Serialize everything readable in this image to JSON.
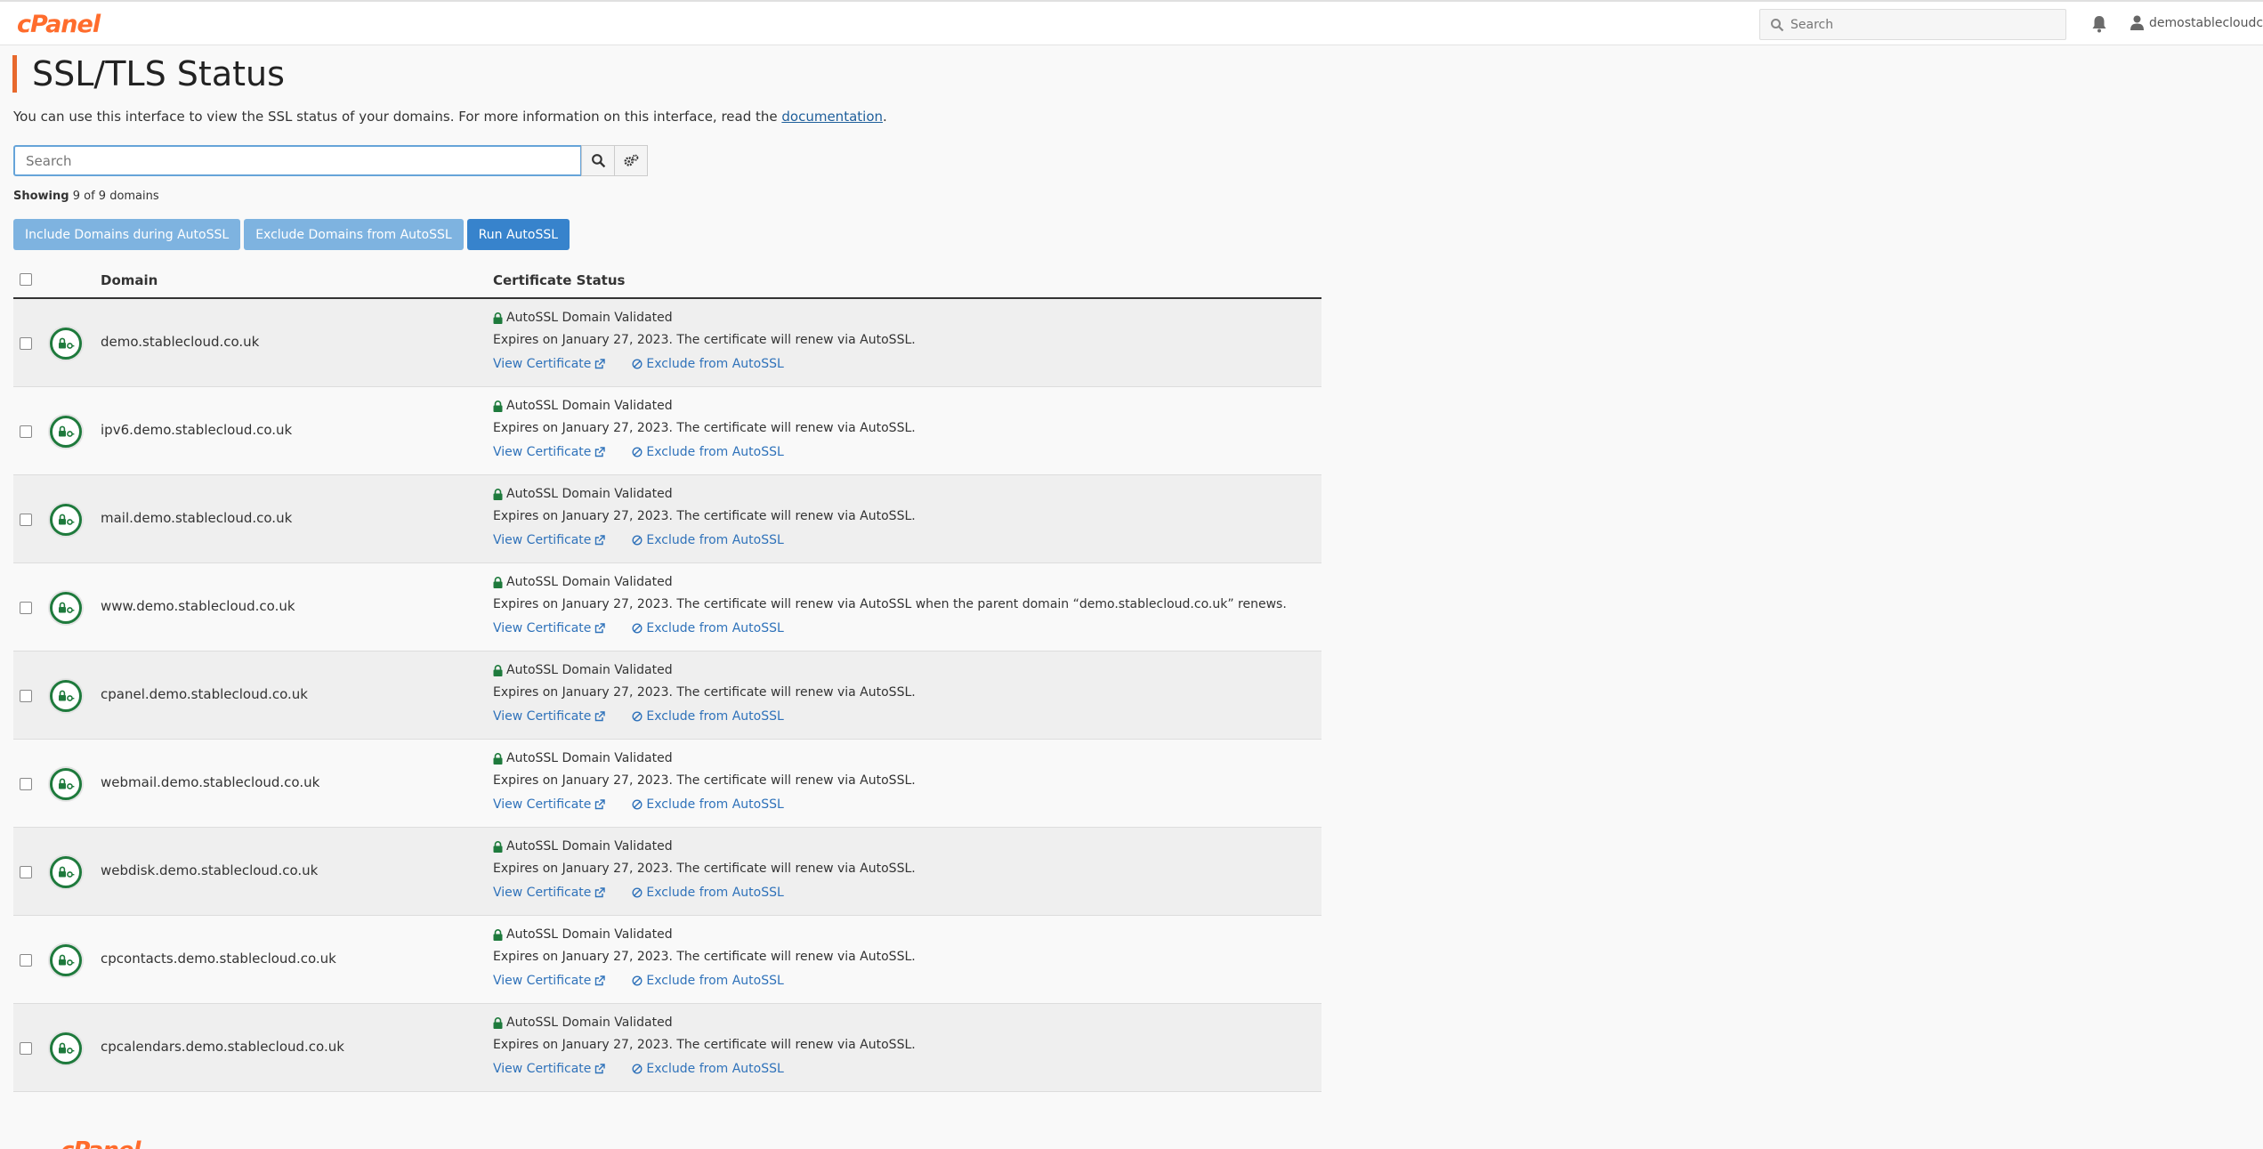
{
  "header": {
    "logo": "cPanel",
    "search_placeholder": "Search",
    "username": "demostablecloudc"
  },
  "page": {
    "title": "SSL/TLS Status",
    "intro_text": "You can use this interface to view the SSL status of your domains. For more information on this interface, read the ",
    "intro_link": "documentation",
    "intro_end": ".",
    "search_placeholder": "Search",
    "showing_label": "Showing",
    "showing_count": "9 of 9 domains"
  },
  "buttons": {
    "include": "Include Domains during AutoSSL",
    "exclude": "Exclude Domains from AutoSSL",
    "run": "Run AutoSSL"
  },
  "table": {
    "col_domain": "Domain",
    "col_status": "Certificate Status",
    "rows": [
      {
        "domain": "demo.stablecloud.co.uk",
        "status": "AutoSSL Domain Validated",
        "expiry": "Expires on January 27, 2023. The certificate will renew via AutoSSL.",
        "view": "View Certificate",
        "exclude": "Exclude from AutoSSL"
      },
      {
        "domain": "ipv6.demo.stablecloud.co.uk",
        "status": "AutoSSL Domain Validated",
        "expiry": "Expires on January 27, 2023. The certificate will renew via AutoSSL.",
        "view": "View Certificate",
        "exclude": "Exclude from AutoSSL"
      },
      {
        "domain": "mail.demo.stablecloud.co.uk",
        "status": "AutoSSL Domain Validated",
        "expiry": "Expires on January 27, 2023. The certificate will renew via AutoSSL.",
        "view": "View Certificate",
        "exclude": "Exclude from AutoSSL"
      },
      {
        "domain": "www.demo.stablecloud.co.uk",
        "status": "AutoSSL Domain Validated",
        "expiry": "Expires on January 27, 2023. The certificate will renew via AutoSSL when the parent domain “demo.stablecloud.co.uk” renews.",
        "view": "View Certificate",
        "exclude": "Exclude from AutoSSL"
      },
      {
        "domain": "cpanel.demo.stablecloud.co.uk",
        "status": "AutoSSL Domain Validated",
        "expiry": "Expires on January 27, 2023. The certificate will renew via AutoSSL.",
        "view": "View Certificate",
        "exclude": "Exclude from AutoSSL"
      },
      {
        "domain": "webmail.demo.stablecloud.co.uk",
        "status": "AutoSSL Domain Validated",
        "expiry": "Expires on January 27, 2023. The certificate will renew via AutoSSL.",
        "view": "View Certificate",
        "exclude": "Exclude from AutoSSL"
      },
      {
        "domain": "webdisk.demo.stablecloud.co.uk",
        "status": "AutoSSL Domain Validated",
        "expiry": "Expires on January 27, 2023. The certificate will renew via AutoSSL.",
        "view": "View Certificate",
        "exclude": "Exclude from AutoSSL"
      },
      {
        "domain": "cpcontacts.demo.stablecloud.co.uk",
        "status": "AutoSSL Domain Validated",
        "expiry": "Expires on January 27, 2023. The certificate will renew via AutoSSL.",
        "view": "View Certificate",
        "exclude": "Exclude from AutoSSL"
      },
      {
        "domain": "cpcalendars.demo.stablecloud.co.uk",
        "status": "AutoSSL Domain Validated",
        "expiry": "Expires on January 27, 2023. The certificate will renew via AutoSSL.",
        "view": "View Certificate",
        "exclude": "Exclude from AutoSSL"
      }
    ]
  },
  "footer": {
    "logo": "cPanel"
  },
  "colors": {
    "brand": "#ff6c2c",
    "accent_border": "#e8692d",
    "link": "#2f72ba",
    "primary_button": "#3783cc",
    "secondary_button": "#7eb3e0",
    "valid_green": "#1e7a3c"
  }
}
